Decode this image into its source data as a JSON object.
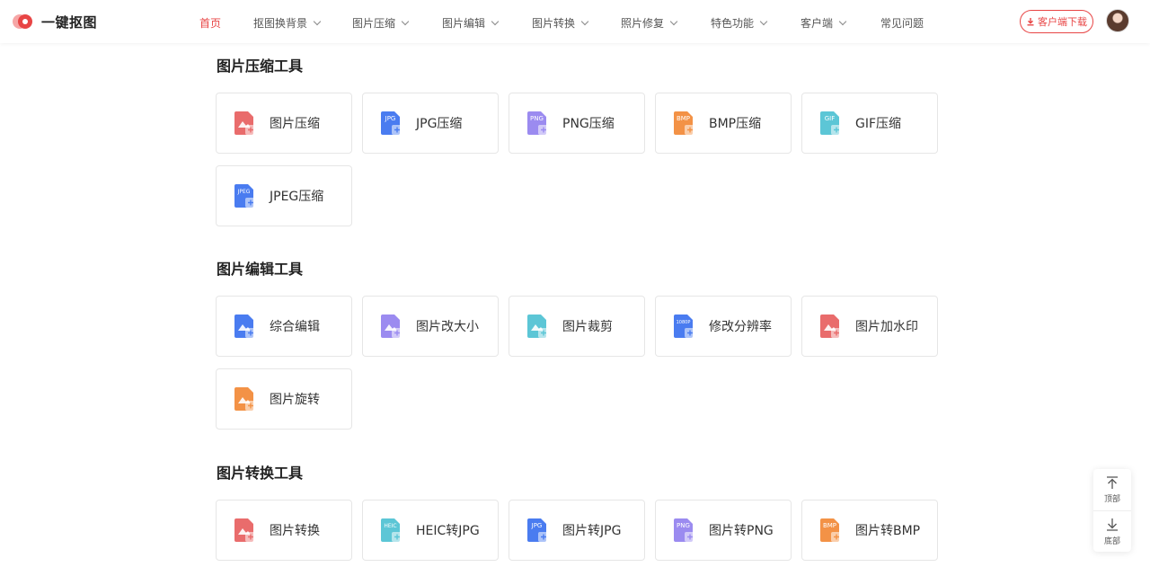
{
  "brand": {
    "name": "一键抠图"
  },
  "nav": {
    "items": [
      {
        "label": "首页",
        "active": true,
        "dropdown": false
      },
      {
        "label": "抠图换背景",
        "active": false,
        "dropdown": true
      },
      {
        "label": "图片压缩",
        "active": false,
        "dropdown": true
      },
      {
        "label": "图片编辑",
        "active": false,
        "dropdown": true
      },
      {
        "label": "图片转换",
        "active": false,
        "dropdown": true
      },
      {
        "label": "照片修复",
        "active": false,
        "dropdown": true
      },
      {
        "label": "特色功能",
        "active": false,
        "dropdown": true
      },
      {
        "label": "客户端",
        "active": false,
        "dropdown": true
      },
      {
        "label": "常见问题",
        "active": false,
        "dropdown": false
      }
    ]
  },
  "header": {
    "download_label": "客户端下载"
  },
  "sections": [
    {
      "title": "图片压缩工具",
      "tools": [
        {
          "label": "图片压缩",
          "icon": "image-compress-icon",
          "color": "#e96c6c",
          "badge": ""
        },
        {
          "label": "JPG压缩",
          "icon": "jpg-compress-icon",
          "color": "#4a7cf0",
          "badge": "JPG"
        },
        {
          "label": "PNG压缩",
          "icon": "png-compress-icon",
          "color": "#9b8bf0",
          "badge": "PNG"
        },
        {
          "label": "BMP压缩",
          "icon": "bmp-compress-icon",
          "color": "#f39246",
          "badge": "BMP"
        },
        {
          "label": "GIF压缩",
          "icon": "gif-compress-icon",
          "color": "#5cc6d6",
          "badge": "GIF"
        },
        {
          "label": "JPEG压缩",
          "icon": "jpeg-compress-icon",
          "color": "#4a7cf0",
          "badge": "JPEG"
        }
      ]
    },
    {
      "title": "图片编辑工具",
      "tools": [
        {
          "label": "综合编辑",
          "icon": "edit-icon",
          "color": "#4a7cf0",
          "badge": ""
        },
        {
          "label": "图片改大小",
          "icon": "resize-icon",
          "color": "#9b8bf0",
          "badge": ""
        },
        {
          "label": "图片裁剪",
          "icon": "crop-icon",
          "color": "#5cc6d6",
          "badge": ""
        },
        {
          "label": "修改分辨率",
          "icon": "resolution-icon",
          "color": "#4a7cf0",
          "badge": "1080P"
        },
        {
          "label": "图片加水印",
          "icon": "watermark-icon",
          "color": "#e96c6c",
          "badge": ""
        },
        {
          "label": "图片旋转",
          "icon": "rotate-icon",
          "color": "#f39246",
          "badge": ""
        }
      ]
    },
    {
      "title": "图片转换工具",
      "tools": [
        {
          "label": "图片转换",
          "icon": "image-convert-icon",
          "color": "#e96c6c",
          "badge": ""
        },
        {
          "label": "HEIC转JPG",
          "icon": "heic-to-jpg-icon",
          "color": "#5cc6d6",
          "badge": "HEIC"
        },
        {
          "label": "图片转JPG",
          "icon": "to-jpg-icon",
          "color": "#4a7cf0",
          "badge": "JPG"
        },
        {
          "label": "图片转PNG",
          "icon": "to-png-icon",
          "color": "#9b8bf0",
          "badge": "PNG"
        },
        {
          "label": "图片转BMP",
          "icon": "to-bmp-icon",
          "color": "#f39246",
          "badge": "BMP"
        }
      ]
    }
  ],
  "side_float": {
    "top_label": "顶部",
    "bottom_label": "底部"
  }
}
